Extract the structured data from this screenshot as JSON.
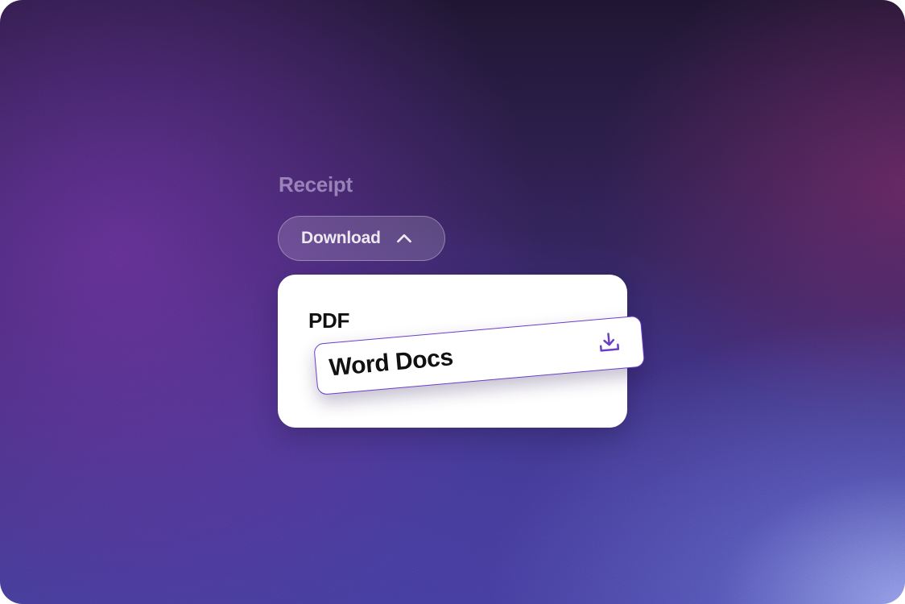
{
  "section": {
    "title": "Receipt"
  },
  "download_button": {
    "label": "Download",
    "icon": "chevron-up-icon"
  },
  "dropdown": {
    "options": [
      {
        "label": "PDF"
      },
      {
        "label": "Word Docs",
        "icon": "download-icon",
        "hovered": true
      }
    ]
  },
  "colors": {
    "accent": "#6a3fc8",
    "panel": "#ffffff",
    "text_dark": "#111111",
    "label_muted": "#cdbee6"
  }
}
